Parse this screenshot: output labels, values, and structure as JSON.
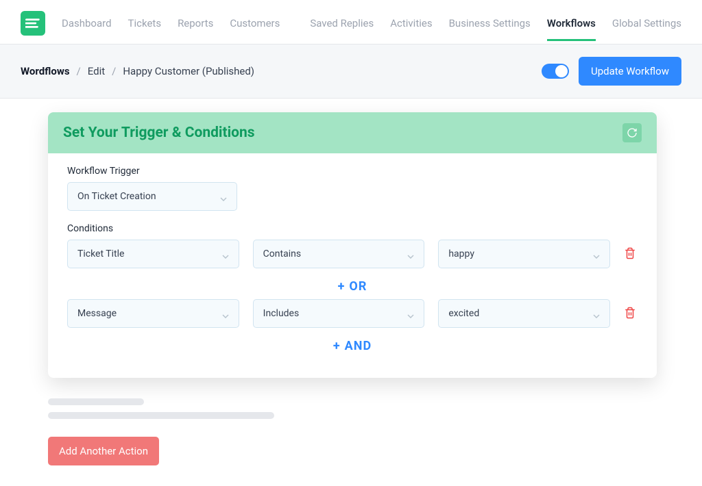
{
  "nav": {
    "left": [
      "Dashboard",
      "Tickets",
      "Reports",
      "Customers"
    ],
    "right": [
      "Saved Replies",
      "Activities",
      "Business Settings",
      "Workflows",
      "Global Settings"
    ],
    "active": "Workflows"
  },
  "breadcrumb": {
    "root": "Wordflows",
    "mid": "Edit",
    "leaf": "Happy Customer (Published)"
  },
  "update_button": "Update Workflow",
  "card": {
    "title": "Set Your Trigger & Conditions",
    "trigger_label": "Workflow Trigger",
    "trigger_value": "On Ticket Creation",
    "conditions_label": "Conditions",
    "rows": [
      {
        "field": "Ticket Title",
        "operator": "Contains",
        "value": "happy"
      },
      {
        "field": "Message",
        "operator": "Includes",
        "value": "excited"
      }
    ],
    "logic": [
      "OR",
      "AND"
    ]
  },
  "add_action": "Add Another Action"
}
